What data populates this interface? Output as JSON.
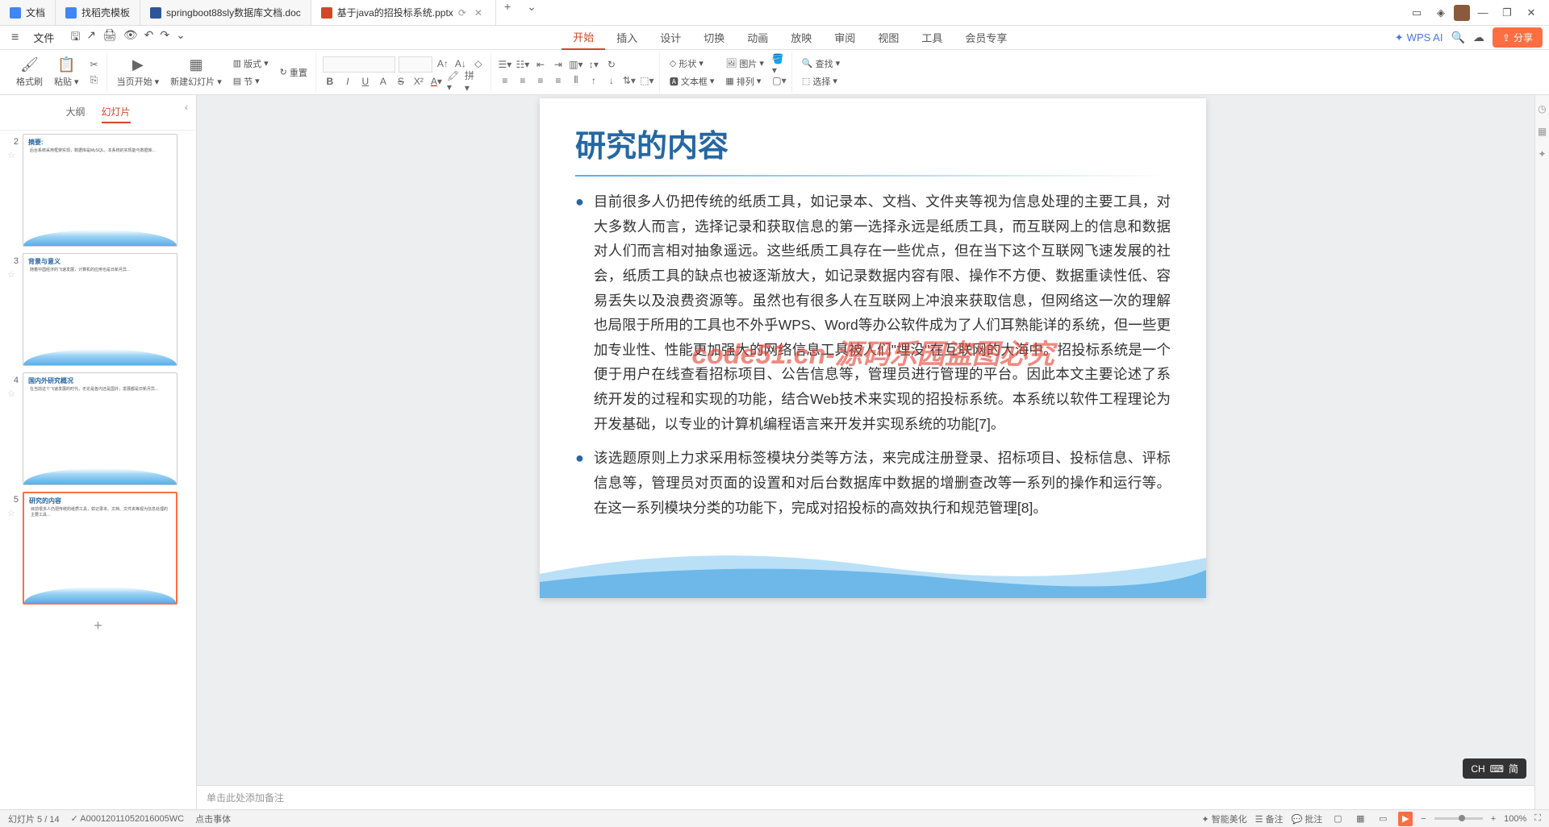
{
  "titlebar": {
    "tabs": [
      {
        "icon": "doc-blue",
        "label": "文档"
      },
      {
        "icon": "doc-blue",
        "label": "找稻壳模板"
      },
      {
        "icon": "doc-word",
        "label": "springboot88sly数据库文档.doc"
      },
      {
        "icon": "doc-ppt",
        "label": "基于java的招投标系统.pptx",
        "active": true
      }
    ],
    "newTab": "+"
  },
  "menubar": {
    "file": "文件",
    "mainTabs": [
      "开始",
      "插入",
      "设计",
      "切换",
      "动画",
      "放映",
      "审阅",
      "视图",
      "工具",
      "会员专享"
    ],
    "activeTab": "开始",
    "wpsAi": "WPS AI",
    "share": "分享"
  },
  "ribbon": {
    "formatPainter": "格式刷",
    "paste": "粘贴",
    "currentPageStart": "当页开始",
    "newSlide": "新建幻灯片",
    "layout": "版式",
    "section": "节",
    "reset": "重置",
    "shapes": "形状",
    "picture": "图片",
    "textbox": "文本框",
    "arrange": "排列",
    "find": "查找",
    "select": "选择"
  },
  "panel": {
    "outline": "大纲",
    "slides": "幻灯片",
    "thumbs": [
      {
        "num": 2,
        "title": "摘要:",
        "lines": "后台系统采用框架实现，数据库是MySQL。本系统的实现能与数据库..."
      },
      {
        "num": 3,
        "title": "背景与意义",
        "lines": "随着中国经济的飞速发展，计算机的应用也是日新月异..."
      },
      {
        "num": 4,
        "title": "国内外研究概况",
        "lines": "在当前这个飞速发展的时代，无论是各内还是国外，发展都是日新月异..."
      },
      {
        "num": 5,
        "title": "研究的内容",
        "lines": "目前很多人仍把传统的纸质工具，如记录本、文档、文件夹等视为信息处理的主要工具...",
        "selected": true
      }
    ]
  },
  "slide": {
    "title": "研究的内容",
    "bullets": [
      "目前很多人仍把传统的纸质工具，如记录本、文档、文件夹等视为信息处理的主要工具，对大多数人而言，选择记录和获取信息的第一选择永远是纸质工具，而互联网上的信息和数据对人们而言相对抽象遥远。这些纸质工具存在一些优点，但在当下这个互联网飞速发展的社会，纸质工具的缺点也被逐渐放大，如记录数据内容有限、操作不方便、数据重读性低、容易丢失以及浪费资源等。虽然也有很多人在互联网上冲浪来获取信息，但网络这一次的理解也局限于所用的工具也不外乎WPS、Word等办公软件成为了人们耳熟能详的系统，但一些更加专业性、性能更加强大的网络信息工具被人们\"埋没\"在互联网的大海中。招投标系统是一个便于用户在线查看招标项目、公告信息等，管理员进行管理的平台。因此本文主要论述了系统开发的过程和实现的功能，结合Web技术来实现的招投标系统。本系统以软件工程理论为开发基础，以专业的计算机编程语言来开发并实现系统的功能[7]。",
      "该选题原则上力求采用标签模块分类等方法，来完成注册登录、招标项目、投标信息、评标信息等，管理员对页面的设置和对后台数据库中数据的增删查改等一系列的操作和运行等。在这一系列模块分类的功能下，完成对招投标的高效执行和规范管理[8]。"
    ],
    "watermark": "code51.cn-源码乐园盗图必究"
  },
  "notes": {
    "placeholder": "单击此处添加备注"
  },
  "statusbar": {
    "slideInfo": "幻灯片 5 / 14",
    "id": "A00012011052016005WC",
    "target": "点击事体",
    "beautify": "智能美化",
    "notes": "备注",
    "comments": "批注",
    "zoom": "100%"
  },
  "ime": {
    "lang": "CH",
    "mode": "简"
  }
}
